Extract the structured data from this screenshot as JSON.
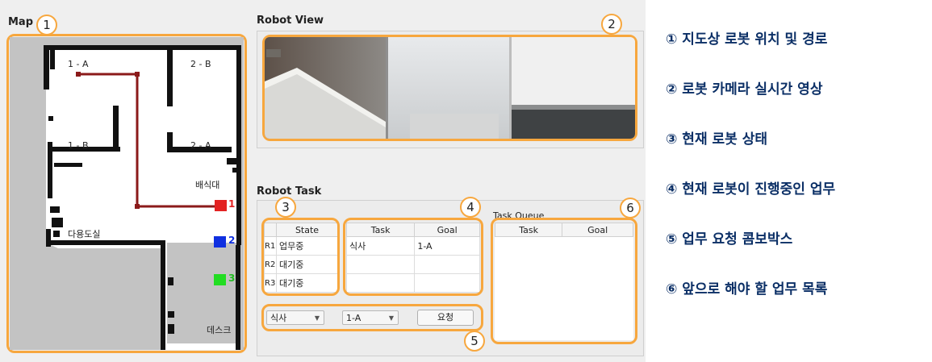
{
  "map": {
    "title": "Map",
    "marker": "1",
    "rooms": [
      "1 - A",
      "2 - B",
      "1 - B",
      "2 - A"
    ],
    "landmarks": {
      "serving": "배식대",
      "study": "다용도실",
      "desk": "데스크"
    },
    "robots": [
      {
        "label": "1",
        "color": "#e32222"
      },
      {
        "label": "2",
        "color": "#1030e0"
      },
      {
        "label": "3",
        "color": "#22dd22"
      }
    ],
    "path_color": "#8b1a1a"
  },
  "robot_view": {
    "title": "Robot View",
    "marker": "2"
  },
  "robot_task": {
    "title": "Robot Task",
    "state_marker": "3",
    "task_marker": "4",
    "request_marker": "5",
    "queue_marker": "6",
    "state_table": {
      "header": "State",
      "rows": [
        {
          "id": "R1",
          "state": "업무중"
        },
        {
          "id": "R2",
          "state": "대기중"
        },
        {
          "id": "R3",
          "state": "대기중"
        }
      ]
    },
    "task_table": {
      "headers": [
        "Task",
        "Goal"
      ],
      "rows": [
        [
          "식사",
          "1-A"
        ],
        [
          "",
          ""
        ],
        [
          "",
          ""
        ]
      ]
    },
    "request": {
      "task_value": "식사",
      "goal_value": "1-A",
      "button": "요청"
    },
    "queue": {
      "title": "Task Queue",
      "headers": [
        "Task",
        "Goal"
      ]
    }
  },
  "legend": [
    "① 지도상 로봇 위치 및 경로",
    "② 로봇 카메라 실시간 영상",
    "③ 현재 로봇 상태",
    "④ 현재 로봇이 진행중인 업무",
    "⑤ 업무 요청 콤보박스",
    "⑥ 앞으로 해야 할 업무 목록"
  ],
  "accent_color": "#f7a73e"
}
